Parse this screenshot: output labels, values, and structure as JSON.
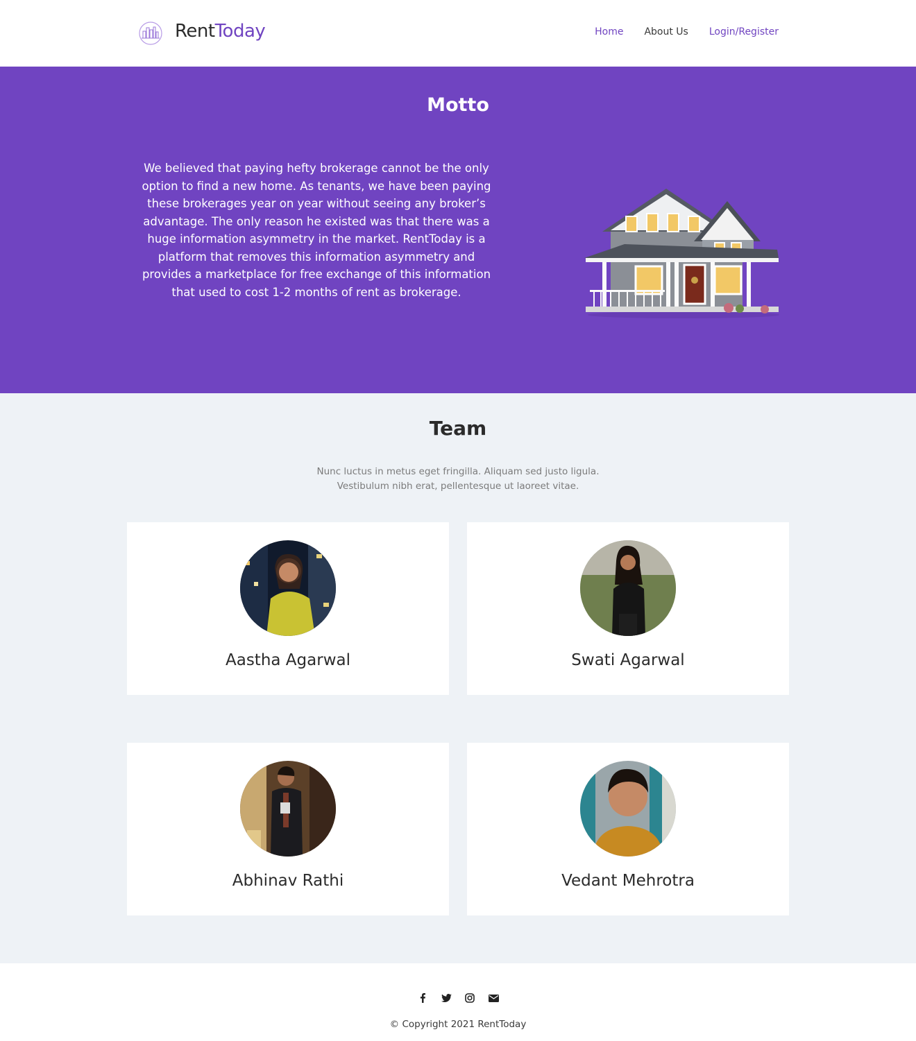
{
  "header": {
    "brand_part1": "Rent",
    "brand_part2": "Today",
    "nav": {
      "home": "Home",
      "about": "About Us",
      "login": "Login/Register"
    }
  },
  "motto": {
    "title": "Motto",
    "text": "We believed that paying hefty brokerage cannot be the only option to find a new home. As tenants, we have been paying these brokerages year on year without seeing any broker’s advantage. The only reason he existed was that there was a huge information asymmetry in the market. RentToday is a platform that removes this information asymmetry and provides a marketplace for free exchange of this information that used to cost 1-2 months of rent as brokerage."
  },
  "team": {
    "title": "Team",
    "subtitle_line1": "Nunc luctus in metus eget fringilla. Aliquam sed justo ligula.",
    "subtitle_line2": "Vestibulum nibh erat, pellentesque ut laoreet vitae.",
    "members": [
      {
        "name": "Aastha Agarwal"
      },
      {
        "name": "Swati Agarwal"
      },
      {
        "name": "Abhinav Rathi"
      },
      {
        "name": "Vedant Mehrotra"
      }
    ]
  },
  "footer": {
    "social_icons": [
      "facebook-icon",
      "twitter-icon",
      "instagram-icon",
      "email-icon"
    ],
    "copyright": "© Copyright 2021 RentToday"
  },
  "colors": {
    "accent": "#7044c1",
    "team_bg": "#eef2f6"
  }
}
